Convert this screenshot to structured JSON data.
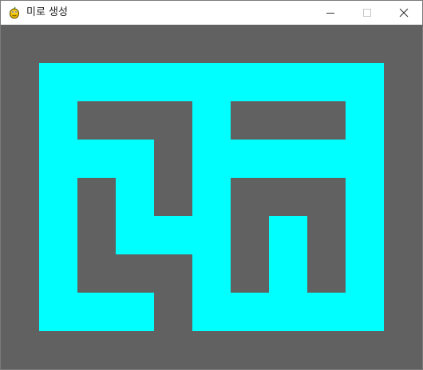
{
  "window": {
    "title": "미로 생성",
    "controls": [
      "minimize",
      "maximize",
      "close"
    ],
    "app_icon": "pygame-snake-icon"
  },
  "maze": {
    "background_color": "#616161",
    "path_color": "#00ffff",
    "grid": {
      "columns": 9,
      "rows": 7
    },
    "path_cells": [
      [
        0,
        0
      ],
      [
        1,
        0
      ],
      [
        2,
        0
      ],
      [
        3,
        0
      ],
      [
        4,
        0
      ],
      [
        5,
        0
      ],
      [
        6,
        0
      ],
      [
        7,
        0
      ],
      [
        8,
        0
      ],
      [
        0,
        1
      ],
      [
        4,
        1
      ],
      [
        8,
        1
      ],
      [
        0,
        2
      ],
      [
        1,
        2
      ],
      [
        2,
        2
      ],
      [
        4,
        2
      ],
      [
        5,
        2
      ],
      [
        6,
        2
      ],
      [
        7,
        2
      ],
      [
        8,
        2
      ],
      [
        0,
        3
      ],
      [
        2,
        3
      ],
      [
        4,
        3
      ],
      [
        8,
        3
      ],
      [
        0,
        4
      ],
      [
        2,
        4
      ],
      [
        3,
        4
      ],
      [
        4,
        4
      ],
      [
        6,
        4
      ],
      [
        8,
        4
      ],
      [
        0,
        5
      ],
      [
        4,
        5
      ],
      [
        6,
        5
      ],
      [
        8,
        5
      ],
      [
        0,
        6
      ],
      [
        1,
        6
      ],
      [
        2,
        6
      ],
      [
        4,
        6
      ],
      [
        5,
        6
      ],
      [
        6,
        6
      ],
      [
        7,
        6
      ],
      [
        8,
        6
      ]
    ]
  }
}
